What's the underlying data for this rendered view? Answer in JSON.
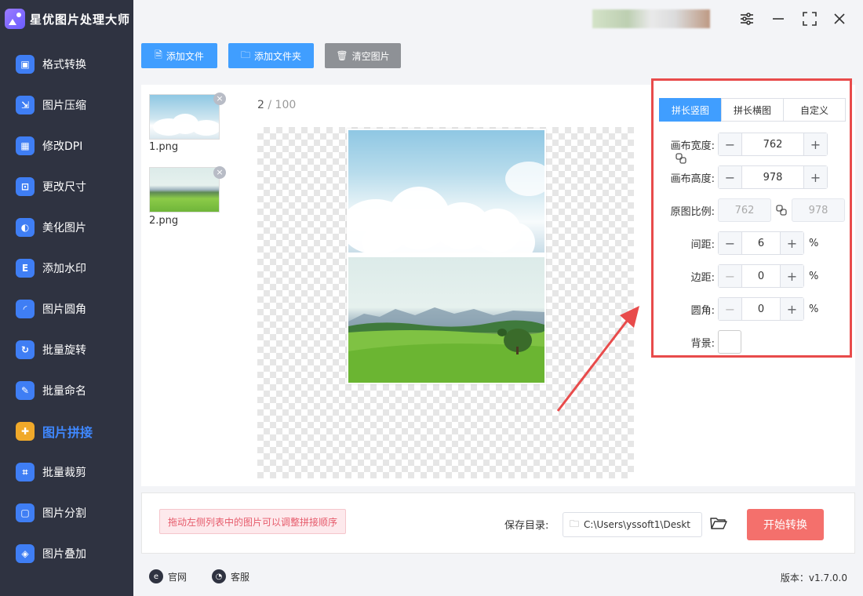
{
  "app": {
    "name": "星优图片处理大师"
  },
  "sidebar": {
    "items": [
      {
        "label": "格式转换",
        "icon": "image-convert-icon",
        "color": "#3f7ef4"
      },
      {
        "label": "图片压缩",
        "icon": "compress-icon",
        "color": "#3f7ef4"
      },
      {
        "label": "修改DPI",
        "icon": "dpi-icon",
        "color": "#3f7ef4"
      },
      {
        "label": "更改尺寸",
        "icon": "resize-icon",
        "color": "#3f7ef4"
      },
      {
        "label": "美化图片",
        "icon": "beautify-icon",
        "color": "#3f7ef4"
      },
      {
        "label": "添加水印",
        "icon": "watermark-icon",
        "color": "#3f7ef4"
      },
      {
        "label": "图片圆角",
        "icon": "rounded-corner-icon",
        "color": "#3f7ef4"
      },
      {
        "label": "批量旋转",
        "icon": "rotate-icon",
        "color": "#3f7ef4"
      },
      {
        "label": "批量命名",
        "icon": "rename-icon",
        "color": "#3f7ef4"
      },
      {
        "label": "图片拼接",
        "icon": "puzzle-icon",
        "color": "#f0a92a",
        "active": true
      },
      {
        "label": "批量裁剪",
        "icon": "crop-icon",
        "color": "#3f7ef4"
      },
      {
        "label": "图片分割",
        "icon": "split-icon",
        "color": "#3f7ef4"
      },
      {
        "label": "图片叠加",
        "icon": "layers-icon",
        "color": "#3f7ef4"
      }
    ]
  },
  "toolbar": {
    "add_file": "添加文件",
    "add_folder": "添加文件夹",
    "clear_images": "清空图片"
  },
  "files": [
    {
      "name": "1.png"
    },
    {
      "name": "2.png"
    }
  ],
  "preview": {
    "current": "2",
    "separator": " / ",
    "total": "100"
  },
  "settings": {
    "tabs": [
      {
        "label": "拼长竖图",
        "active": true
      },
      {
        "label": "拼长横图"
      },
      {
        "label": "自定义"
      }
    ],
    "canvas_width": {
      "label": "画布宽度:",
      "value": "762"
    },
    "canvas_height": {
      "label": "画布高度:",
      "value": "978"
    },
    "original_ratio": {
      "label": "原图比例:",
      "width": "762",
      "height": "978"
    },
    "spacing": {
      "label": "间距:",
      "value": "6",
      "unit": "%"
    },
    "margin": {
      "label": "边距:",
      "value": "0",
      "unit": "%"
    },
    "corner": {
      "label": "圆角:",
      "value": "0",
      "unit": "%"
    },
    "background": {
      "label": "背景:",
      "color": "#ffffff"
    }
  },
  "bottom": {
    "hint": "拖动左侧列表中的图片可以调整拼接顺序",
    "save_label": "保存目录:",
    "save_path": "C:\\Users\\yssoft1\\Deskt",
    "start": "开始转换"
  },
  "footer": {
    "website": "官网",
    "support": "客服",
    "version": "版本：v1.7.0.0"
  },
  "colors": {
    "primary": "#409eff",
    "highlight": "#e84b4b",
    "start": "#f4706c",
    "sidebar": "#2f3341"
  }
}
